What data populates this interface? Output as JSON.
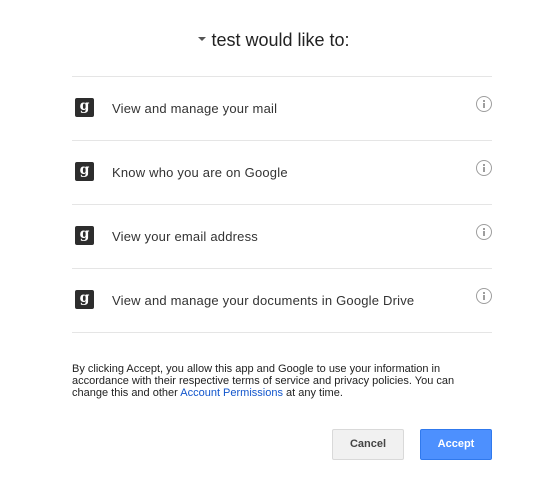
{
  "header": {
    "title": "test would like to:"
  },
  "scopes": [
    {
      "label": "View and manage your mail",
      "icon": "google-g-icon"
    },
    {
      "label": "Know who you are on Google",
      "icon": "google-g-icon"
    },
    {
      "label": "View your email address",
      "icon": "google-g-icon"
    },
    {
      "label": "View and manage your documents in Google Drive",
      "icon": "google-g-icon"
    }
  ],
  "icon_glyph": "g",
  "disclaimer": {
    "text_before": "By clicking Accept, you allow this app and Google to use your information in accordance with their respective terms of service and privacy policies. You can change this and other ",
    "link_text": "Account Permissions",
    "text_after": " at any time."
  },
  "buttons": {
    "cancel": "Cancel",
    "accept": "Accept"
  },
  "colors": {
    "accent": "#4d90fe",
    "link": "#1155cc"
  }
}
